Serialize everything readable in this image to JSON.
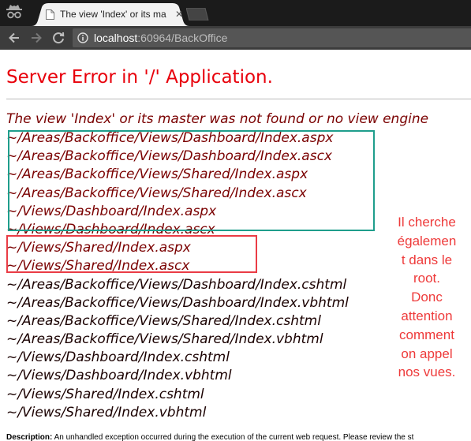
{
  "tab": {
    "title": "The view 'Index' or its ma",
    "close_glyph": "✕"
  },
  "toolbar": {
    "url_host": "localhost",
    "url_rest": ":60964/BackOffice"
  },
  "page": {
    "error_title": "Server Error in '/' Application.",
    "error_message": "The view 'Index' or its master was not found or no view engine",
    "searched_locations": [
      "~/Areas/Backoffice/Views/Dashboard/Index.aspx",
      "~/Areas/Backoffice/Views/Dashboard/Index.ascx",
      "~/Areas/Backoffice/Views/Shared/Index.aspx",
      "~/Areas/Backoffice/Views/Shared/Index.ascx",
      "~/Views/Dashboard/Index.aspx",
      "~/Views/Dashboard/Index.ascx",
      "~/Views/Shared/Index.aspx",
      "~/Views/Shared/Index.ascx",
      "~/Areas/Backoffice/Views/Dashboard/Index.cshtml",
      "~/Areas/Backoffice/Views/Dashboard/Index.vbhtml",
      "~/Areas/Backoffice/Views/Shared/Index.cshtml",
      "~/Areas/Backoffice/Views/Shared/Index.vbhtml",
      "~/Views/Dashboard/Index.cshtml",
      "~/Views/Dashboard/Index.vbhtml",
      "~/Views/Shared/Index.cshtml",
      "~/Views/Shared/Index.vbhtml"
    ],
    "annotation_lines": [
      "Il cherche",
      "égalemen",
      "t dans le",
      "root.",
      "Donc",
      "attention",
      "comment",
      "on appel",
      "nos vues."
    ],
    "description_label": "Description:",
    "description_text": "An unhandled exception occurred during the execution of the current web request. Please review the st"
  },
  "colors": {
    "error_title": "#e8000b",
    "error_text": "#7a0000",
    "highlight_box_teal": "#1f9e8c",
    "highlight_box_red": "#ea3c45",
    "annotation": "#ee3a3a",
    "tabstrip": "#1b1b1b",
    "toolbar": "#3c3c3c",
    "omnibox": "#555555"
  },
  "icons": {
    "incognito": "incognito-icon",
    "favicon": "page-favicon-icon",
    "back": "back-arrow-icon",
    "forward": "forward-arrow-icon",
    "reload": "reload-icon",
    "site_info": "site-info-icon",
    "new_tab": "new-tab-icon"
  }
}
